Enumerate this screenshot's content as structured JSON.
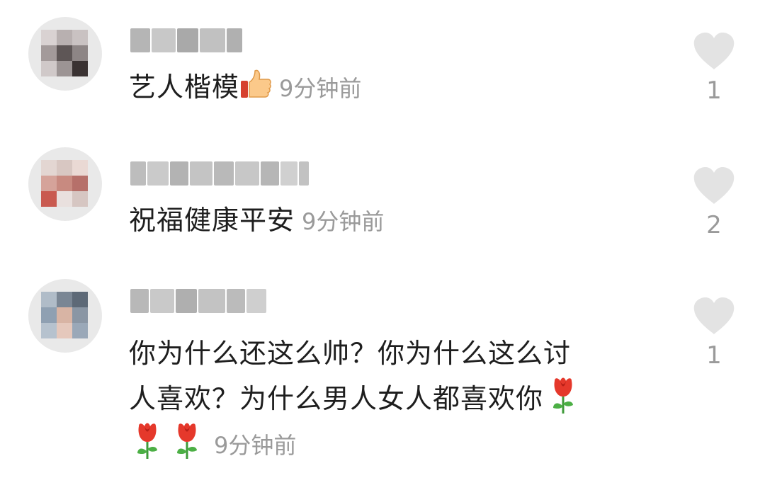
{
  "comments": [
    {
      "username": "",
      "text": "艺人楷模",
      "emoji": "thumbs-up",
      "time": "9分钟前",
      "likes": "1"
    },
    {
      "username": "",
      "text": "祝福健康平安",
      "time": "9分钟前",
      "likes": "2"
    },
    {
      "username": "",
      "text_line1": "你为什么还这么帅？你为什么这么讨",
      "text_line2": "人喜欢？为什么男人女人都喜欢你",
      "emoji": "rose",
      "time": "9分钟前",
      "likes": "1"
    }
  ],
  "icons": {
    "like": "heart-icon",
    "thumbs": "thumbs-up-emoji",
    "rose": "rose-emoji"
  },
  "colors": {
    "text": "#1e1e1e",
    "meta": "#9a9a9a",
    "heart": "#e3e3e3",
    "background": "#ffffff"
  }
}
